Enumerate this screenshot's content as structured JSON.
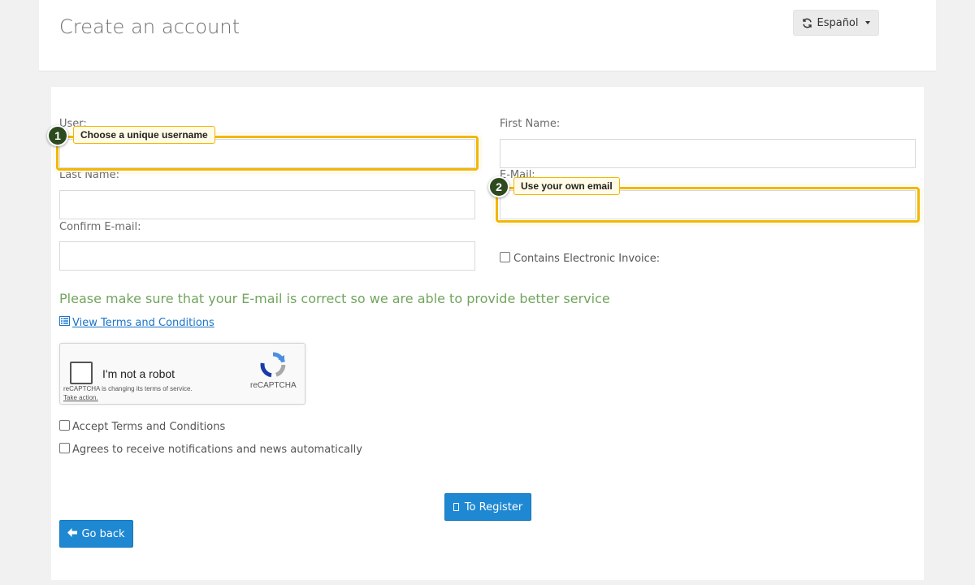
{
  "header": {
    "title": "Create an account",
    "language_label": "Español"
  },
  "form": {
    "user_label": "User:",
    "first_name_label": "First Name:",
    "last_name_label": "Last Name:",
    "email_label": "E-Mail:",
    "confirm_email_label": "Confirm E-mail:",
    "electronic_invoice_label": "Contains Electronic Invoice:",
    "notice": "Please make sure that your E-mail is correct so we are able to provide better service",
    "terms_link": "View Terms and Conditions",
    "accept_terms_label": "Accept Terms and Conditions",
    "notifications_label": "Agrees to receive notifications and news automatically"
  },
  "recaptcha": {
    "label": "I'm not a robot",
    "brand": "reCAPTCHA",
    "note": "reCAPTCHA is changing its terms of service.",
    "action": "Take action."
  },
  "buttons": {
    "register": "To Register",
    "back": "Go back"
  },
  "annotations": [
    {
      "step": "1",
      "text": "Choose a unique username"
    },
    {
      "step": "2",
      "text": "Use your own email"
    }
  ],
  "colors": {
    "highlight": "#f2b705",
    "badge": "#2d4a1e",
    "primary_button": "#1e88d2",
    "notice_text": "#72a55e",
    "link": "#1a73c9"
  },
  "icons": {
    "language": "refresh-icon",
    "terms": "list-icon",
    "back": "arrow-left-icon",
    "register": "square-glyph-icon",
    "captcha": "recaptcha-logo-icon"
  }
}
